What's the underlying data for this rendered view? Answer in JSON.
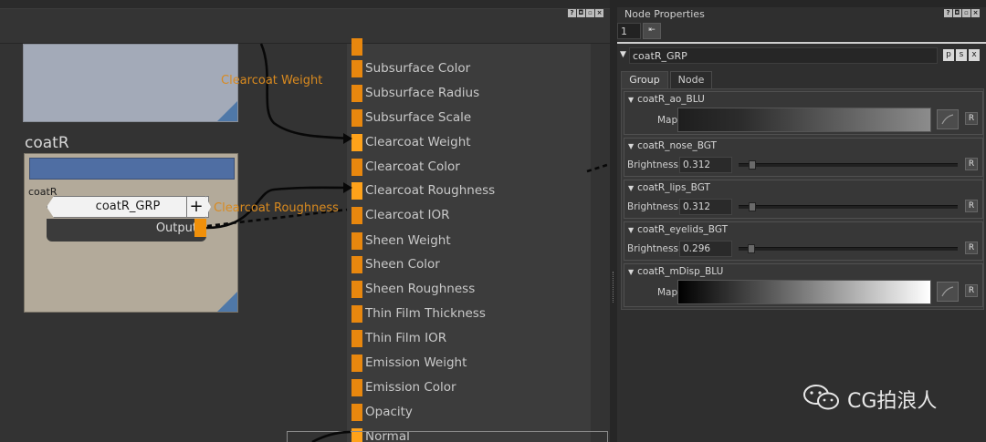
{
  "graph": {
    "node_name": "coatR",
    "node_sub_label": "coatR",
    "group_name": "coatR_GRP",
    "plus_symbol": "+",
    "output_label": "Output",
    "wire_labels": [
      "Clearcoat Weight",
      "Clearcoat Roughness"
    ],
    "inputs": [
      {
        "label": "Subsurface Color"
      },
      {
        "label": "Subsurface Radius"
      },
      {
        "label": "Subsurface Scale"
      },
      {
        "label": "Clearcoat Weight"
      },
      {
        "label": "Clearcoat Color"
      },
      {
        "label": "Clearcoat Roughness"
      },
      {
        "label": "Clearcoat IOR"
      },
      {
        "label": "Sheen Weight"
      },
      {
        "label": "Sheen Color"
      },
      {
        "label": "Sheen Roughness"
      },
      {
        "label": "Thin Film Thickness"
      },
      {
        "label": "Thin Film IOR"
      },
      {
        "label": "Emission Weight"
      },
      {
        "label": "Emission Color"
      },
      {
        "label": "Opacity"
      },
      {
        "label": "Normal"
      }
    ],
    "port_color": "#e8870e",
    "node_color": "#4f6ea3"
  },
  "props": {
    "title": "Node Properties",
    "count_value": "1",
    "collapse_btn": "⇤",
    "group_name": "coatR_GRP",
    "header_btns": [
      "p",
      "s",
      "x"
    ],
    "tabs": [
      {
        "label": "Group"
      },
      {
        "label": "Node"
      }
    ],
    "sections": [
      {
        "name": "coatR_ao_BLU",
        "row_label": "Map"
      },
      {
        "name": "coatR_nose_BGT",
        "row_label": "Brightness",
        "value": "0.312",
        "level": 0.312
      },
      {
        "name": "coatR_lips_BGT",
        "row_label": "Brightness",
        "value": "0.312",
        "level": 0.312
      },
      {
        "name": "coatR_eyelids_BGT",
        "row_label": "Brightness",
        "value": "0.296",
        "level": 0.296
      },
      {
        "name": "coatR_mDisp_BLU",
        "row_label": "Map"
      }
    ],
    "reset_label": "R"
  },
  "watermark": {
    "text": "CG拍浪人",
    "icon": "wechat-icon"
  }
}
